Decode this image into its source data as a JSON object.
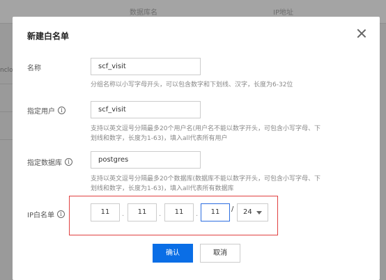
{
  "background": {
    "col1": "数据库名",
    "col2": "IP地址",
    "fragment": "nclo"
  },
  "modal": {
    "title": "新建白名单",
    "fields": {
      "name": {
        "label": "名称",
        "value": "scf_visit",
        "hint": "分组名称以小写字母开头，可以包含数字和下划线、汉字，长度为6-32位"
      },
      "user": {
        "label": "指定用户",
        "value": "scf_visit",
        "hint_line1": "支持以英文逗号分隔最多20个用户名(用户名不能以数字开头，可包含小写字母、下",
        "hint_line2": "划线和数字，长度为1-63)，填入all代表所有用户"
      },
      "database": {
        "label": "指定数据库",
        "value": "postgres",
        "hint_line1": "支持以英文逗号分隔最多20个数据库(数据库不能以数字开头，可包含小写字母、下",
        "hint_line2": "划线和数字，长度为1-63)，填入all代表所有数据库"
      },
      "ip": {
        "label": "IP白名单",
        "octets": [
          "11",
          "11",
          "11",
          "11"
        ],
        "separator": ".",
        "slash": "/",
        "mask": "24"
      }
    },
    "buttons": {
      "confirm": "确认",
      "cancel": "取消"
    },
    "help_glyph": "i"
  },
  "colors": {
    "primary": "#0a6ee6",
    "highlight_box": "#e04040",
    "active_input": "#2d6ee0"
  },
  "icons": {
    "close": "close-icon",
    "help": "help-circle-icon",
    "dropdown": "chevron-down-icon"
  }
}
